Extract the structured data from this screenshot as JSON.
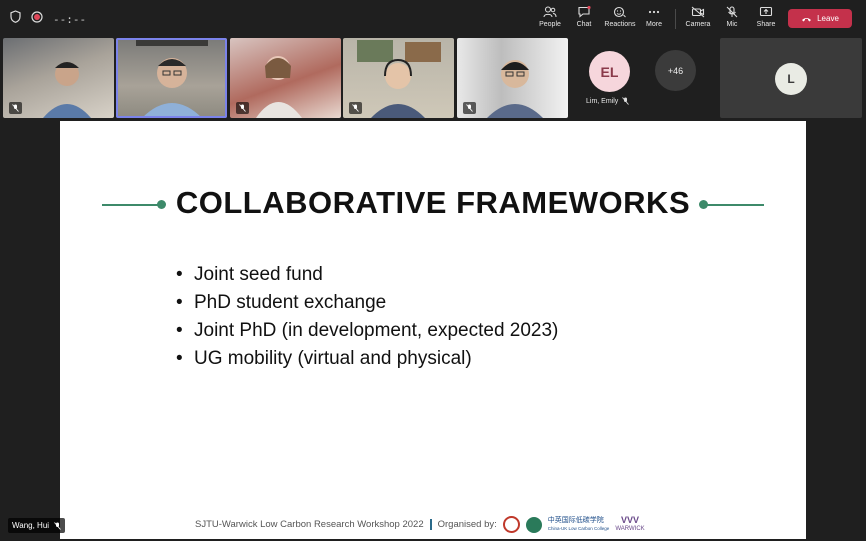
{
  "toolbar": {
    "timer": "--:--",
    "people": "People",
    "chat": "Chat",
    "reactions": "Reactions",
    "more": "More",
    "camera": "Camera",
    "mic": "Mic",
    "share": "Share",
    "leave": "Leave"
  },
  "participants": {
    "emily_initials": "EL",
    "emily_name": "Lim, Emily",
    "overflow_count": "+46",
    "l_initial": "L"
  },
  "slide": {
    "title": "COLLABORATIVE FRAMEWORKS",
    "bullets": [
      "Joint seed fund",
      "PhD student exchange",
      "Joint PhD (in development, expected 2023)",
      "UG mobility (virtual and physical)"
    ],
    "footer_event": "SJTU-Warwick Low Carbon Research Workshop 2022",
    "footer_organised": "Organised by:",
    "logo_cn": "中英国际低碳学院",
    "logo_en": "China-UK Low Carbon College",
    "logo_warwick": "WARWICK"
  },
  "self": {
    "name": "Wang, Hui"
  },
  "colors": {
    "accent_green": "#3d8a6a",
    "leave_red": "#c4314b",
    "active_outline": "#7b83eb"
  }
}
